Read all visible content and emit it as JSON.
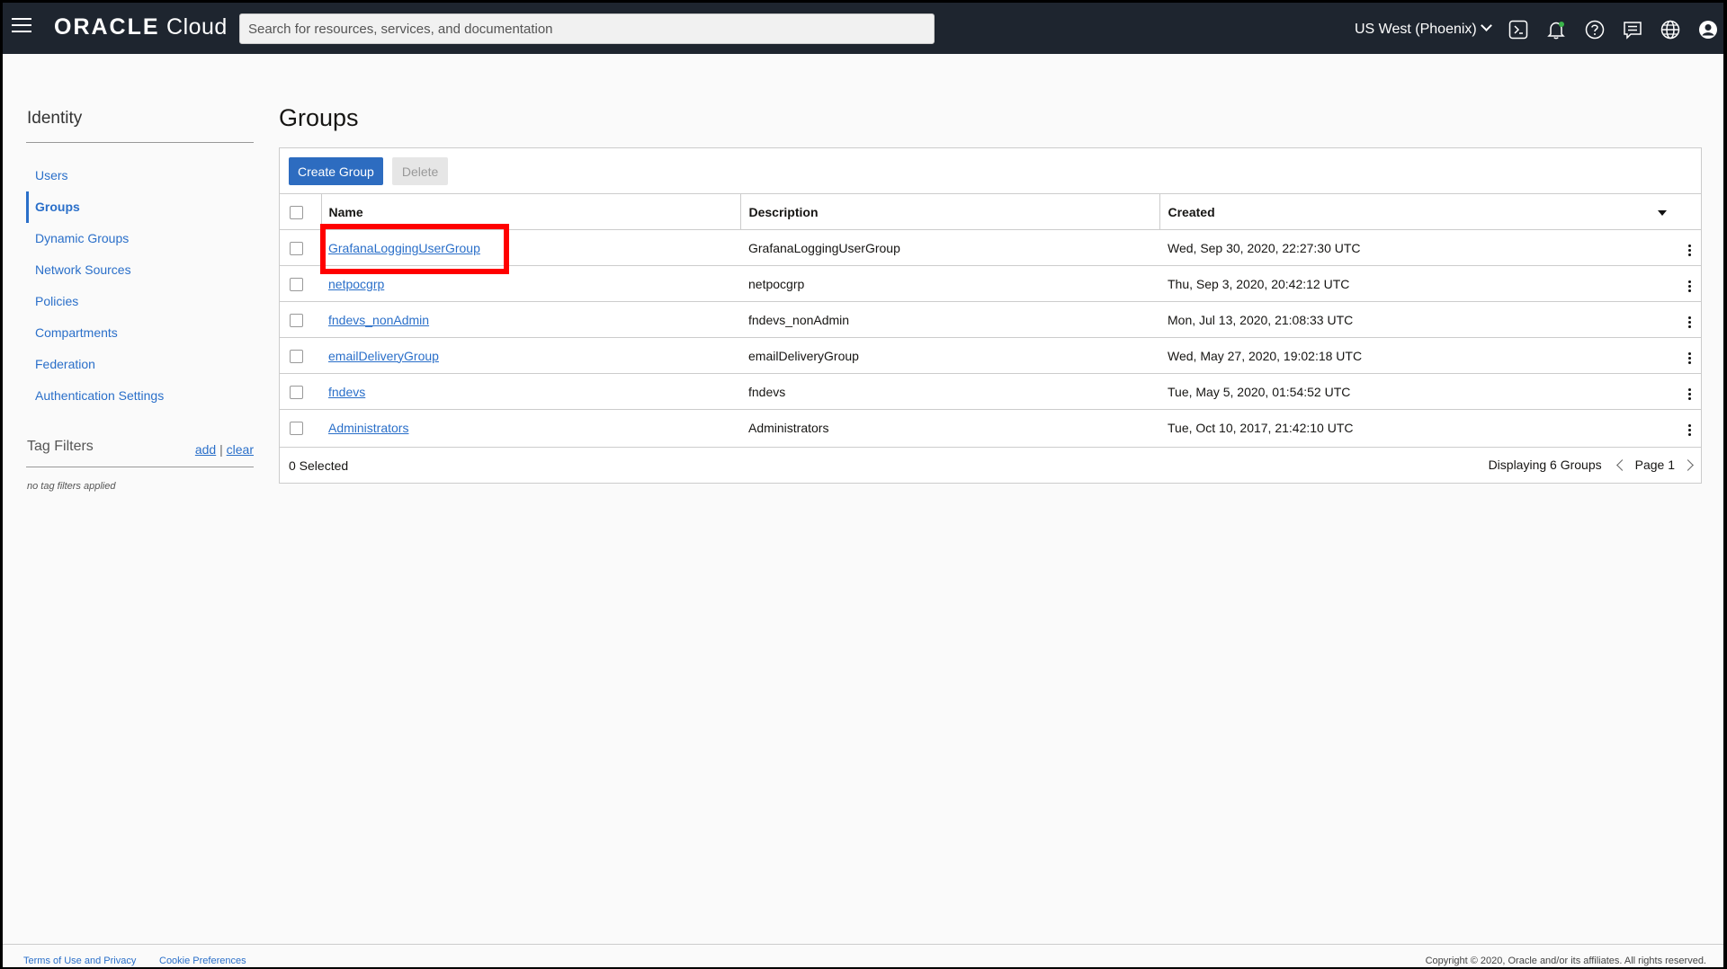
{
  "header": {
    "logo_brand": "ORACLE",
    "logo_product": "Cloud",
    "search_placeholder": "Search for resources, services, and documentation",
    "region": "US West (Phoenix)",
    "icons": [
      "menu-icon",
      "cloud-shell-icon",
      "bell-icon",
      "help-icon",
      "chat-icon",
      "globe-icon",
      "profile-icon"
    ]
  },
  "sidebar": {
    "title": "Identity",
    "items": [
      {
        "label": "Users"
      },
      {
        "label": "Groups",
        "active": true
      },
      {
        "label": "Dynamic Groups"
      },
      {
        "label": "Network Sources"
      },
      {
        "label": "Policies"
      },
      {
        "label": "Compartments"
      },
      {
        "label": "Federation"
      },
      {
        "label": "Authentication Settings"
      }
    ],
    "tag_filters": {
      "title": "Tag Filters",
      "add": "add",
      "separator": "|",
      "clear": "clear",
      "empty_text": "no tag filters applied"
    }
  },
  "main": {
    "title": "Groups",
    "buttons": {
      "create": "Create Group",
      "delete": "Delete"
    },
    "columns": {
      "name": "Name",
      "description": "Description",
      "created": "Created"
    },
    "rows": [
      {
        "name": "GrafanaLoggingUserGroup",
        "description": "GrafanaLoggingUserGroup",
        "created": "Wed, Sep 30, 2020, 22:27:30 UTC"
      },
      {
        "name": "netpocgrp",
        "description": "netpocgrp",
        "created": "Thu, Sep 3, 2020, 20:42:12 UTC"
      },
      {
        "name": "fndevs_nonAdmin",
        "description": "fndevs_nonAdmin",
        "created": "Mon, Jul 13, 2020, 21:08:33 UTC"
      },
      {
        "name": "emailDeliveryGroup",
        "description": "emailDeliveryGroup",
        "created": "Wed, May 27, 2020, 19:02:18 UTC"
      },
      {
        "name": "fndevs",
        "description": "fndevs",
        "created": "Tue, May 5, 2020, 01:54:52 UTC"
      },
      {
        "name": "Administrators",
        "description": "Administrators",
        "created": "Tue, Oct 10, 2017, 21:42:10 UTC"
      }
    ],
    "selected_count": "0 Selected",
    "display_count": "Displaying 6 Groups",
    "page": "Page 1"
  },
  "footer": {
    "terms": "Terms of Use and Privacy",
    "cookies": "Cookie Preferences",
    "copyright": "Copyright © 2020, Oracle and/or its affiliates. All rights reserved."
  },
  "colors": {
    "topbar": "#1e252f",
    "link": "#2a6fc9",
    "primary_button": "#2d6cc0",
    "highlight_box": "#ff0000"
  }
}
